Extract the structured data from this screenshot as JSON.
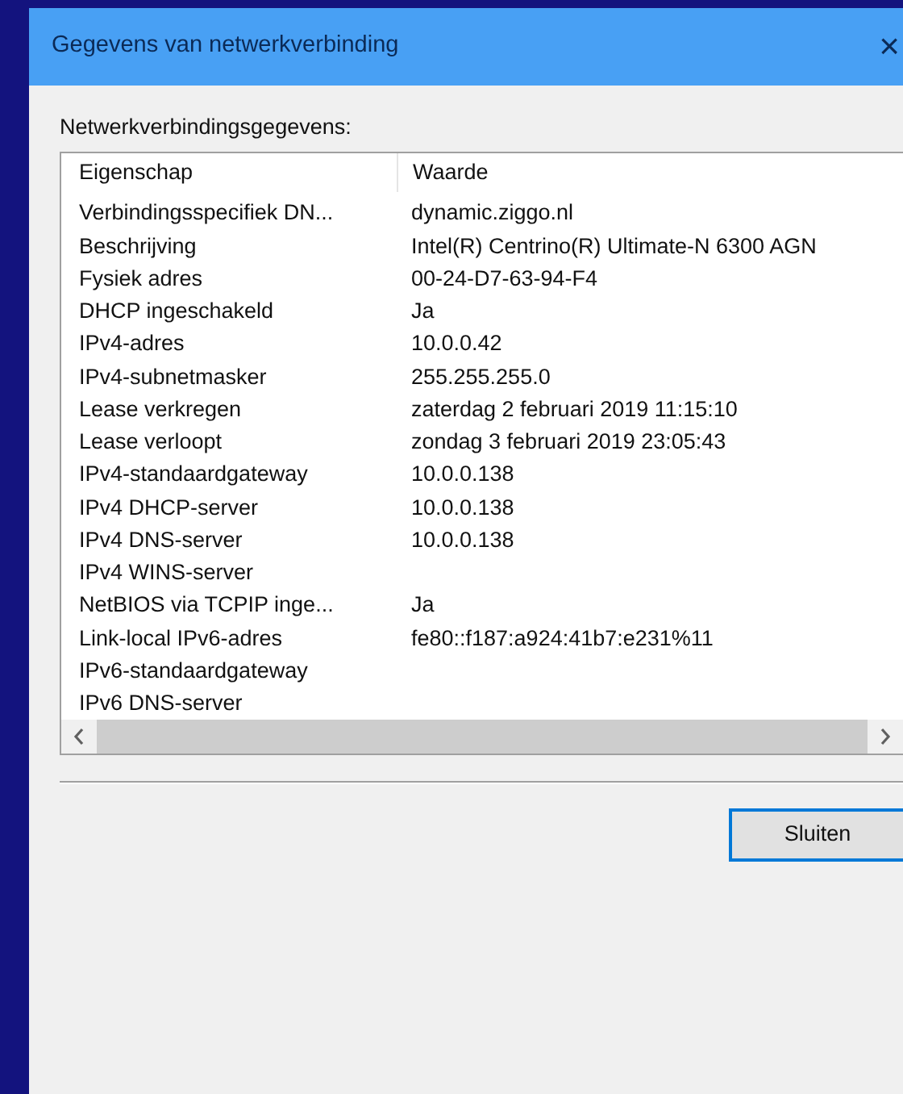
{
  "window": {
    "title": "Gegevens van netwerkverbinding",
    "close": "×"
  },
  "group_label": "Netwerkverbindingsgegevens:",
  "list": {
    "columns": [
      "Eigenschap",
      "Waarde"
    ],
    "rows": [
      {
        "property": "Verbindingsspecifiek DN...",
        "value": "dynamic.ziggo.nl"
      },
      {
        "property": "Beschrijving",
        "value": "Intel(R) Centrino(R) Ultimate-N 6300 AGN"
      },
      {
        "property": "Fysiek adres",
        "value": "00-24-D7-63-94-F4"
      },
      {
        "property": "DHCP ingeschakeld",
        "value": "Ja"
      },
      {
        "property": "IPv4-adres",
        "value": "10.0.0.42"
      },
      {
        "property": "IPv4-subnetmasker",
        "value": "255.255.255.0"
      },
      {
        "property": "Lease verkregen",
        "value": "zaterdag 2 februari 2019 11:15:10"
      },
      {
        "property": "Lease verloopt",
        "value": "zondag 3 februari 2019 23:05:43"
      },
      {
        "property": "IPv4-standaardgateway",
        "value": "10.0.0.138"
      },
      {
        "property": "IPv4 DHCP-server",
        "value": "10.0.0.138"
      },
      {
        "property": "IPv4 DNS-server",
        "value": "10.0.0.138"
      },
      {
        "property": "IPv4 WINS-server"
      },
      {
        "property": "NetBIOS via TCPIP inge...",
        "value": "Ja"
      },
      {
        "property": "Link-local IPv6-adres",
        "value": "fe80::f187:a924:41b7:e231%11"
      },
      {
        "property": "IPv6-standaardgateway"
      },
      {
        "property": "IPv6 DNS-server"
      }
    ]
  },
  "buttons": [
    "Sluiten"
  ]
}
